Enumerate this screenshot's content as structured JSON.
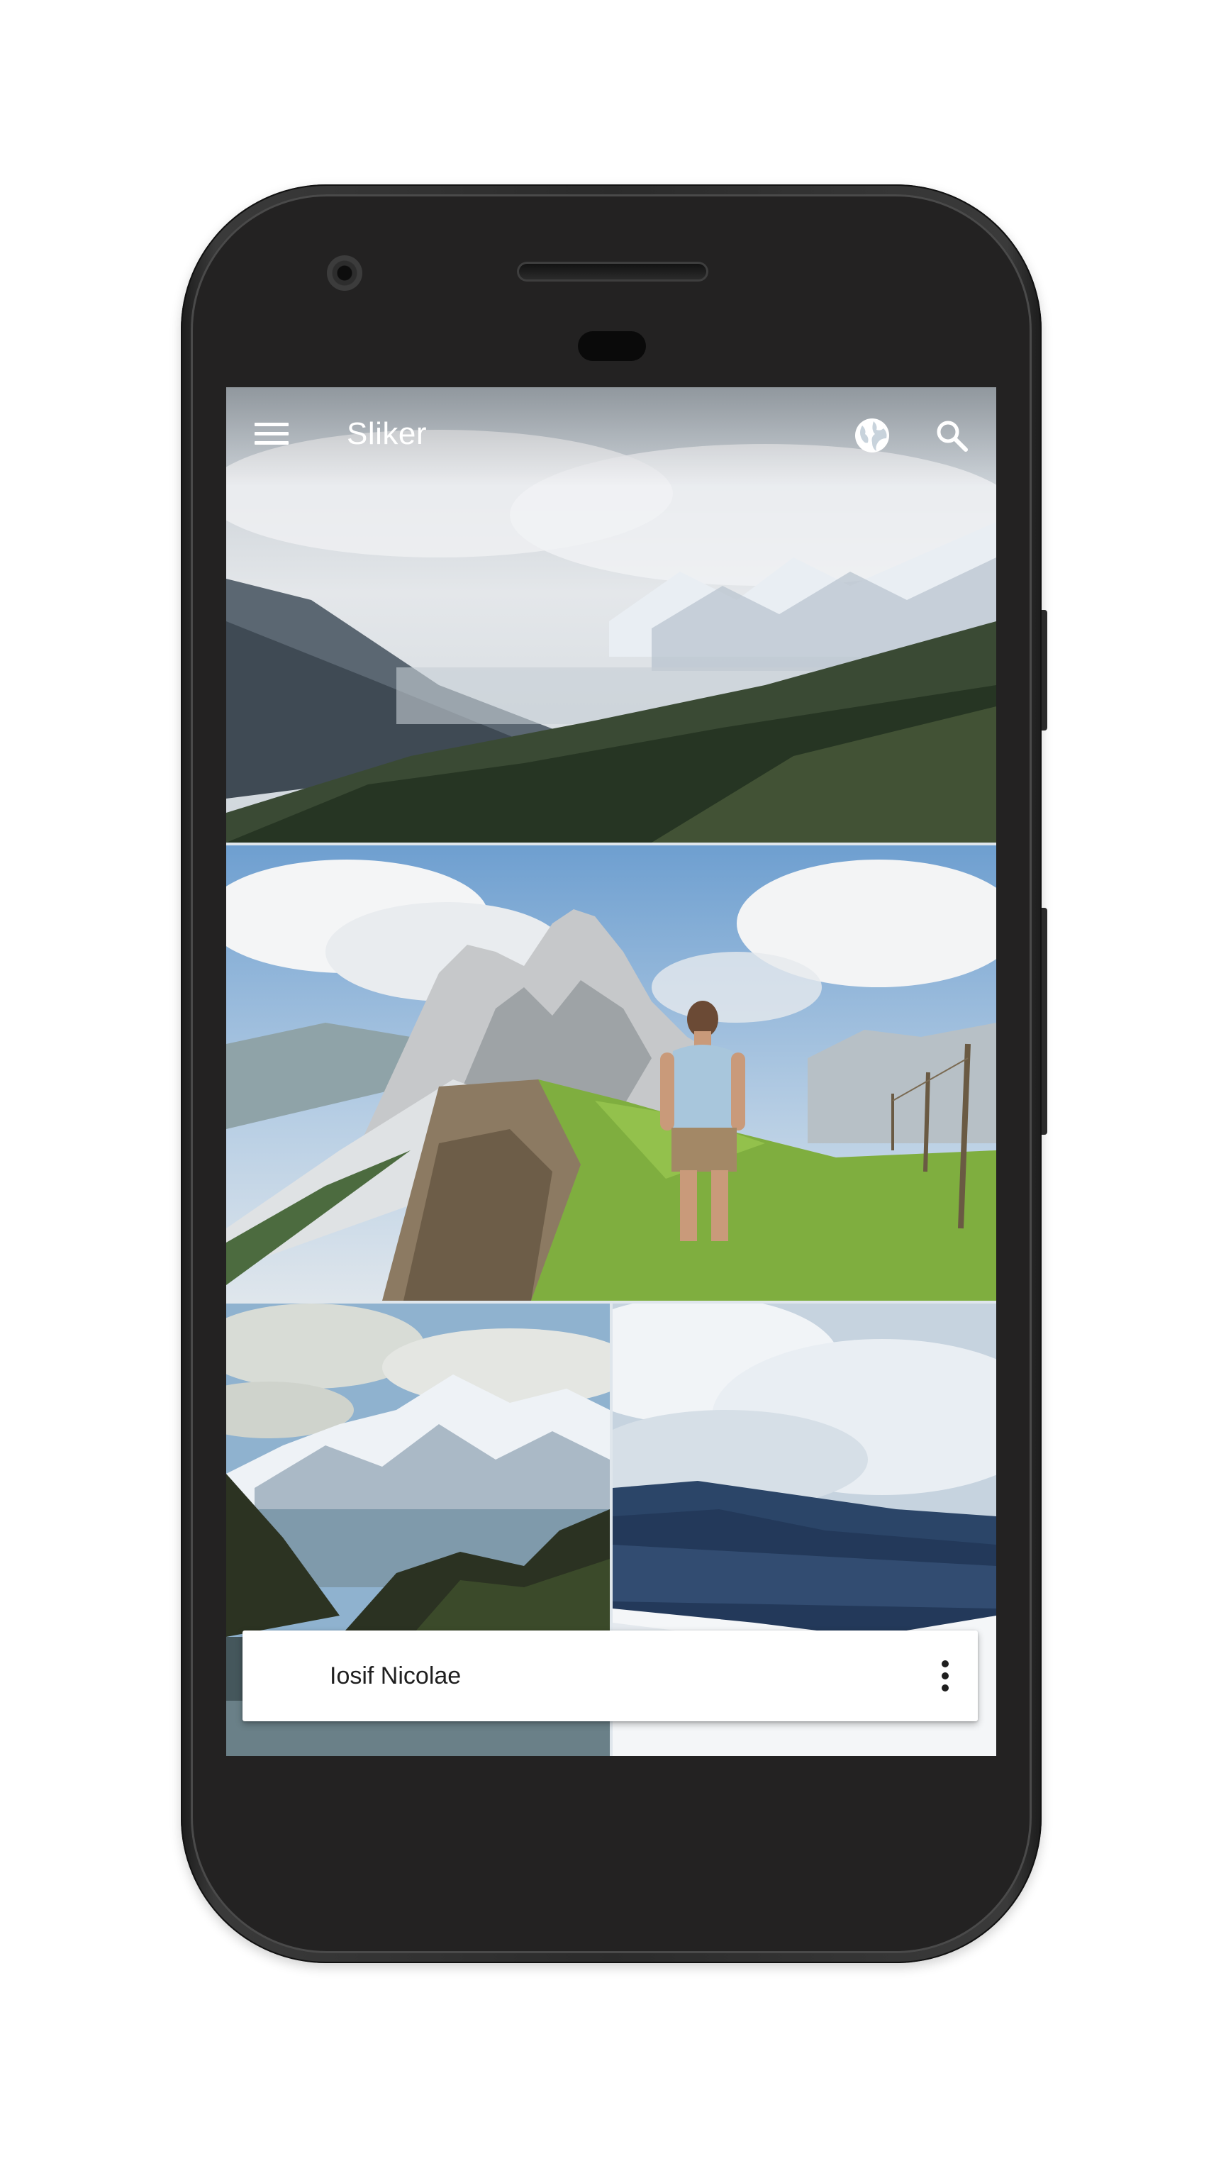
{
  "app": {
    "title": "Sliker"
  },
  "toolbar": {
    "menu_icon": "hamburger-menu-icon",
    "globe_icon": "globe-icon",
    "search_icon": "search-icon"
  },
  "feed": {
    "photos": [
      {
        "subject": "cloudy mountain valley"
      },
      {
        "subject": "hiker overlooking alpine peaks"
      },
      {
        "subject": "glacier lake below snowy mountains"
      },
      {
        "subject": "snow-covered forest under clouds"
      }
    ]
  },
  "author_card": {
    "name": "Iosif Nicolae",
    "menu_icon": "more-vert-icon"
  },
  "colors": {
    "phone_body": "#232222",
    "card_background": "#ffffff",
    "title_text": "#ffffff"
  }
}
